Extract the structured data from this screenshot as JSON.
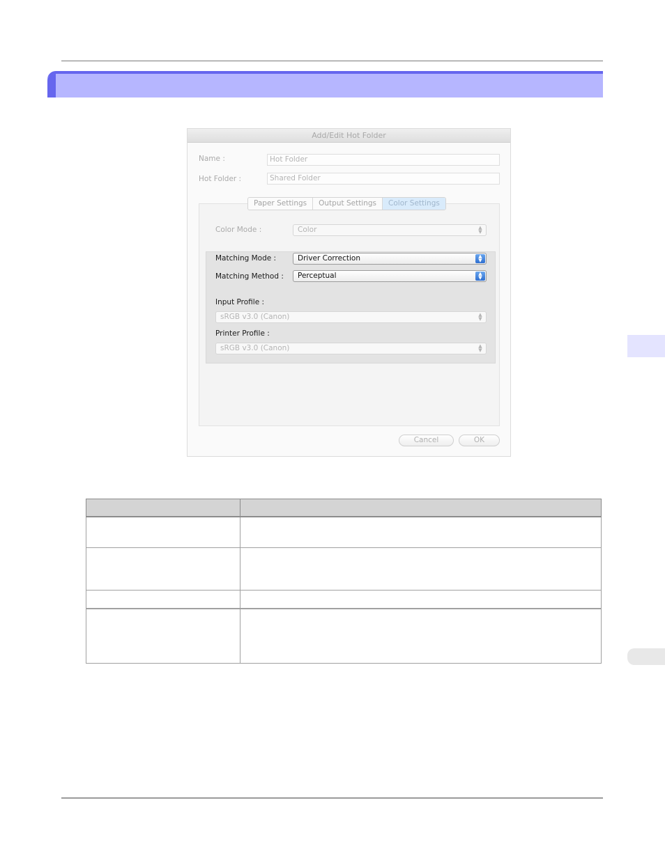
{
  "dialog": {
    "title": "Add/Edit Hot Folder",
    "name_label": "Name :",
    "name_value": "Hot Folder",
    "hot_folder_label": "Hot Folder :",
    "hot_folder_value": "Shared Folder",
    "tabs": [
      "Paper Settings",
      "Output Settings",
      "Color Settings"
    ],
    "active_tab": "Color Settings",
    "color_mode_label": "Color Mode :",
    "color_mode_value": "Color",
    "matching_mode_label": "Matching Mode :",
    "matching_mode_value": "Driver Correction",
    "matching_method_label": "Matching Method :",
    "matching_method_value": "Perceptual",
    "input_profile_label": "Input Profile :",
    "input_profile_value": "sRGB v3.0 (Canon)",
    "printer_profile_label": "Printer Profile :",
    "printer_profile_value": "sRGB v3.0 (Canon)",
    "cancel_label": "Cancel",
    "ok_label": "OK"
  },
  "colors": {
    "banner": "#b6b6ff",
    "banner_edge": "#6666ee",
    "side_tab": "#e4e4ff",
    "accent_blue": "#2f6fd0"
  }
}
